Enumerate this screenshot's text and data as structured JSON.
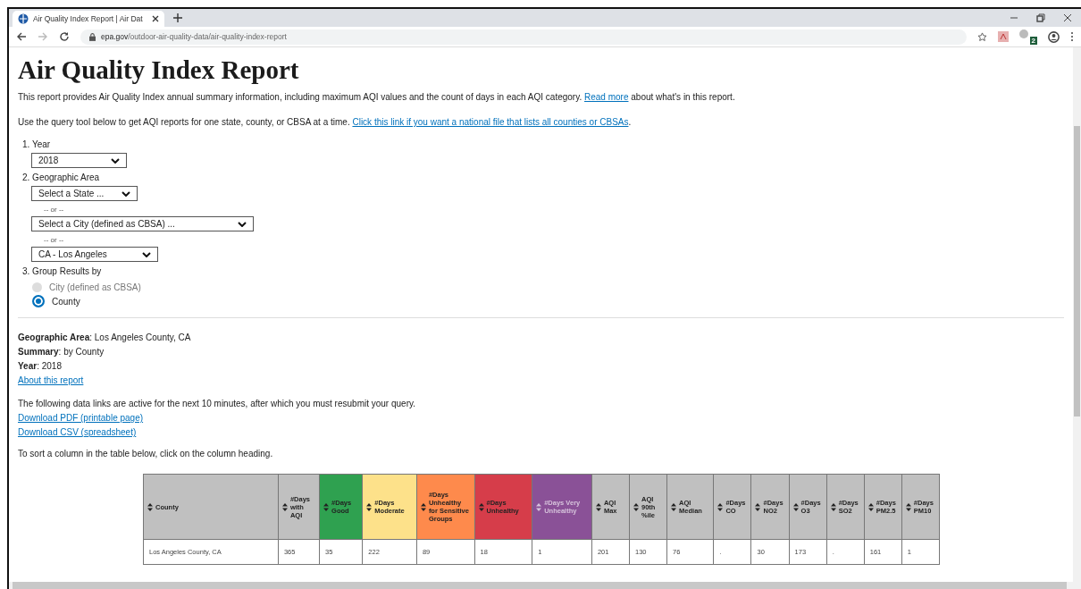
{
  "browser": {
    "tab_title": "Air Quality Index Report | Air Dat",
    "url_host": "epa.gov",
    "url_path": "/outdoor-air-quality-data/air-quality-index-report",
    "extension_badge": "2"
  },
  "page": {
    "title": "Air Quality Index Report",
    "intro": [
      {
        "before": "This report provides Air Quality Index annual summary information, including maximum AQI values and the count of days in each AQI category. ",
        "link": "Read more",
        "after": " about what's in this report."
      },
      {
        "before": "Use the query tool below to get AQI reports for one state, county, or CBSA at a time. ",
        "link": "Click this link if you want a national file that lists all counties or CBSAs",
        "after": "."
      }
    ],
    "form": {
      "year_label": "1. Year",
      "year": "2018",
      "area_label": "2. Geographic Area",
      "area_fields": [
        {
          "kind": "select",
          "value": "Select a State ..."
        },
        {
          "kind": "separator",
          "value": "-- or --"
        },
        {
          "kind": "select",
          "value": "Select a City (defined as CBSA) ..."
        },
        {
          "kind": "separator",
          "value": "-- or --"
        },
        {
          "kind": "select",
          "value": "CA - Los Angeles"
        }
      ],
      "group_label": "3. Group Results by",
      "group_options": [
        {
          "label": "City (defined as CBSA)",
          "selected": false
        },
        {
          "label": "County",
          "selected": true
        }
      ]
    },
    "summary": [
      "**Geographic Area**: Los Angeles County, CA",
      "**Summary**: by County",
      "**Year**: 2018"
    ],
    "about_link": "About this report",
    "links_note": "The following data links are active for the next 10 minutes, after which you must resubmit your query.",
    "download_links": [
      "Download PDF (printable page)",
      "Download CSV (spreadsheet)"
    ],
    "sort_note": "To sort a column in the table below, click on the column heading.",
    "table": {
      "columns": [
        {
          "label": "County",
          "color": "#c0c0c0"
        },
        {
          "label": "#Days with AQI",
          "color": "#c0c0c0"
        },
        {
          "label": "#Days Good",
          "color": "#2fa150"
        },
        {
          "label": "#Days Moderate",
          "color": "#fde18a"
        },
        {
          "label": "#Days Unhealthy for Sensitive Groups",
          "color": "#fe8a4c"
        },
        {
          "label": "#Days Unhealthy",
          "color": "#d63d4a"
        },
        {
          "label": "#Days Very Unhealthy",
          "color": "#8a5197"
        },
        {
          "label": "AQI Max",
          "color": "#c0c0c0"
        },
        {
          "label": "AQI 90th %ile",
          "color": "#c0c0c0"
        },
        {
          "label": "AQI Median",
          "color": "#c0c0c0"
        },
        {
          "label": "#Days CO",
          "color": "#c0c0c0"
        },
        {
          "label": "#Days NO2",
          "color": "#c0c0c0"
        },
        {
          "label": "#Days O3",
          "color": "#c0c0c0"
        },
        {
          "label": "#Days SO2",
          "color": "#c0c0c0"
        },
        {
          "label": "#Days PM2.5",
          "color": "#c0c0c0"
        },
        {
          "label": "#Days PM10",
          "color": "#c0c0c0"
        }
      ],
      "rows": [
        [
          "Los Angeles County, CA",
          "365",
          "35",
          "222",
          "89",
          "18",
          "1",
          "201",
          "130",
          "76",
          ".",
          "30",
          "173",
          ".",
          "161",
          "1"
        ]
      ]
    }
  }
}
